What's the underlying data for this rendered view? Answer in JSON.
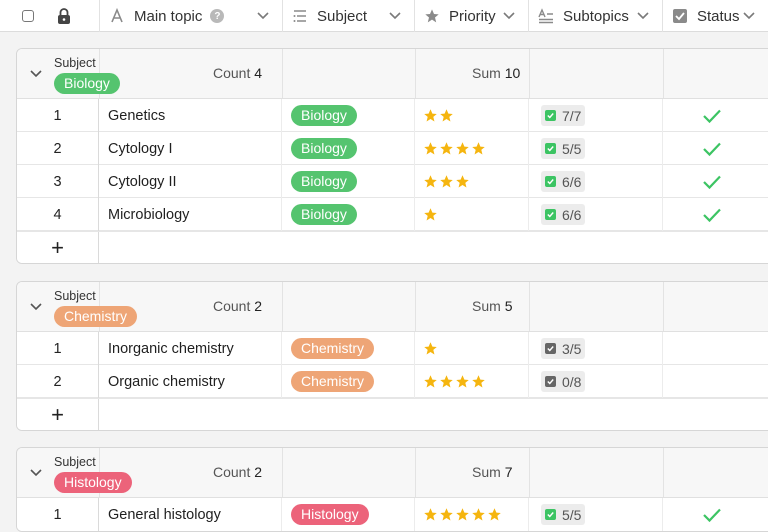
{
  "columns": {
    "main_topic": "Main topic",
    "subject": "Subject",
    "priority": "Priority",
    "subtopics": "Subtopics",
    "status": "Status"
  },
  "colors": {
    "Biology": "#55c46f",
    "Chemistry": "#eea576",
    "Histology": "#ec637a",
    "star": "#f5b50f",
    "check": "#3cc463"
  },
  "groups": [
    {
      "field_label": "Subject",
      "name": "Biology",
      "count_label": "Count",
      "count": "4",
      "sum_label": "Sum",
      "sum": "10",
      "rows": [
        {
          "num": "1",
          "topic": "Genetics",
          "subject": "Biology",
          "priority": 2,
          "subtopics": "7/7",
          "sub_done": true,
          "status": true
        },
        {
          "num": "2",
          "topic": "Cytology I",
          "subject": "Biology",
          "priority": 4,
          "subtopics": "5/5",
          "sub_done": true,
          "status": true
        },
        {
          "num": "3",
          "topic": "Cytology II",
          "subject": "Biology",
          "priority": 3,
          "subtopics": "6/6",
          "sub_done": true,
          "status": true
        },
        {
          "num": "4",
          "topic": "Microbiology",
          "subject": "Biology",
          "priority": 1,
          "subtopics": "6/6",
          "sub_done": true,
          "status": true
        }
      ],
      "add": "+"
    },
    {
      "field_label": "Subject",
      "name": "Chemistry",
      "count_label": "Count",
      "count": "2",
      "sum_label": "Sum",
      "sum": "5",
      "rows": [
        {
          "num": "1",
          "topic": "Inorganic chemistry",
          "subject": "Chemistry",
          "priority": 1,
          "subtopics": "3/5",
          "sub_done": false,
          "status": false
        },
        {
          "num": "2",
          "topic": "Organic chemistry",
          "subject": "Chemistry",
          "priority": 4,
          "subtopics": "0/8",
          "sub_done": false,
          "status": false
        }
      ],
      "add": "+"
    },
    {
      "field_label": "Subject",
      "name": "Histology",
      "count_label": "Count",
      "count": "2",
      "sum_label": "Sum",
      "sum": "7",
      "rows": [
        {
          "num": "1",
          "topic": "General histology",
          "subject": "Histology",
          "priority": 5,
          "subtopics": "5/5",
          "sub_done": true,
          "status": true
        }
      ],
      "add": "+"
    }
  ]
}
